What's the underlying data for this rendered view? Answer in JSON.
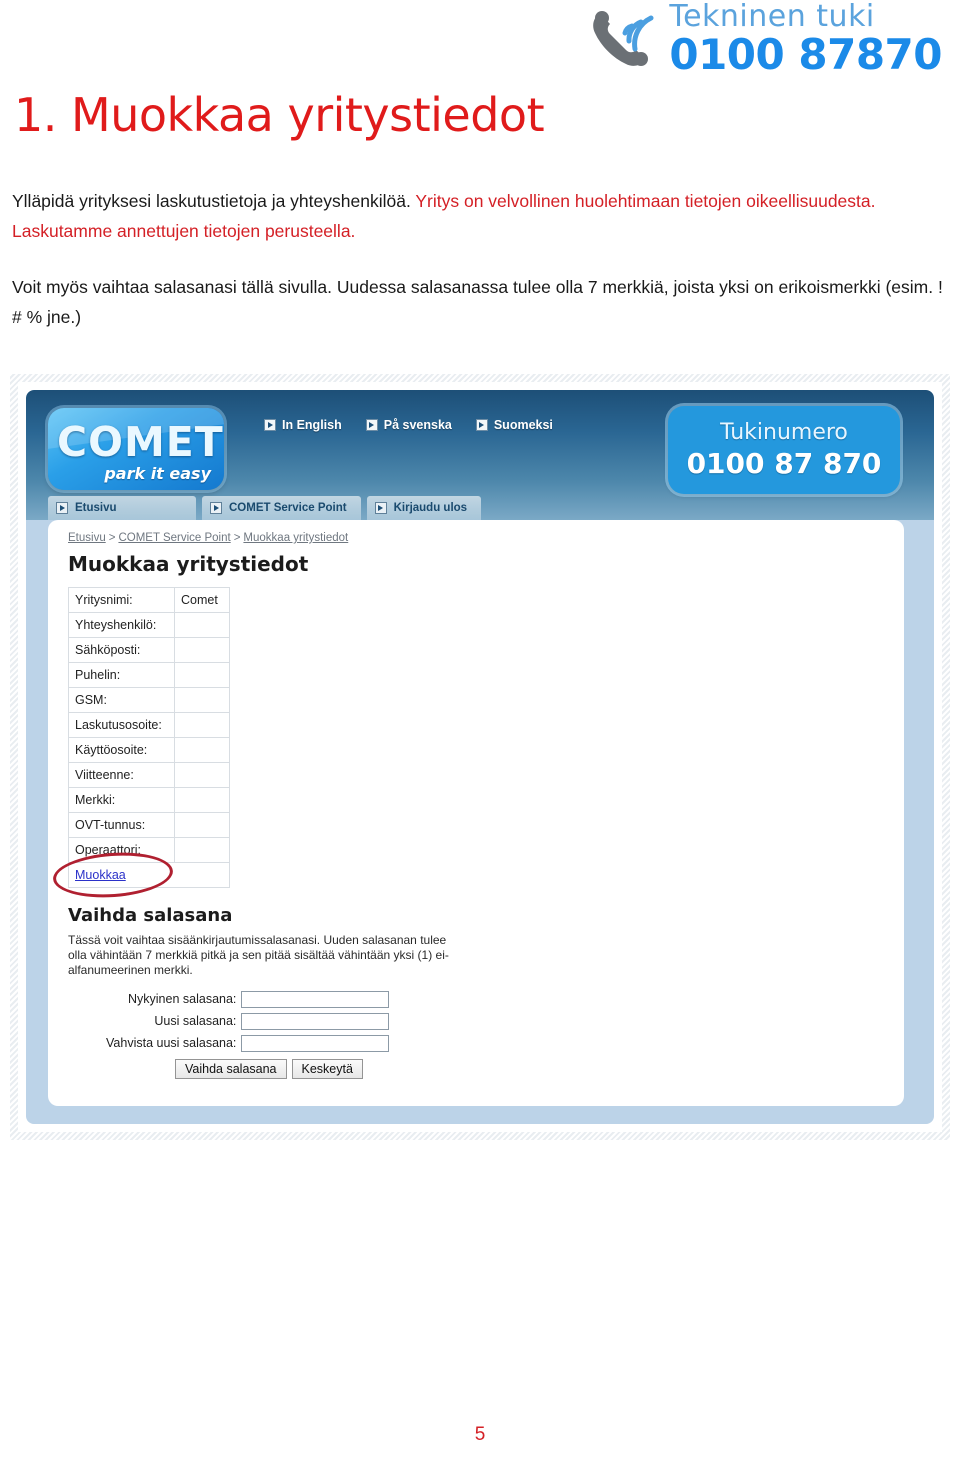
{
  "doc": {
    "support": {
      "label": "Tekninen tuki",
      "number": "0100 87870",
      "icon": "phone-ringing-icon"
    },
    "title": "1. Muokkaa yritystiedot",
    "paragraph1_black": "Ylläpidä yrityksesi laskutustietoja ja yhteyshenkilöä. ",
    "paragraph1_red": "Yritys on velvollinen huolehtimaan tietojen oikeellisuudesta. Laskutamme annettujen tietojen perusteella.",
    "paragraph2": "Voit myös vaihtaa salasanasi tällä sivulla. Uudessa salasanassa tulee olla 7 merkkiä, joista yksi on erikoismerkki (esim. ! # % jne.)",
    "page_number": "5",
    "colors": {
      "accent_red": "#d42026",
      "brand_blue": "#1b8ae8",
      "link_blue": "#2b31c9",
      "annotation_red": "#b02030"
    }
  },
  "screenshot": {
    "logo": {
      "word": "COMET",
      "tagline": "park it easy"
    },
    "languages": [
      {
        "label": "In English",
        "icon": "play-square-icon"
      },
      {
        "label": "På svenska",
        "icon": "play-square-icon"
      },
      {
        "label": "Suomeksi",
        "icon": "play-square-icon"
      }
    ],
    "support_badge": {
      "label": "Tukinumero",
      "number": "0100 87 870"
    },
    "nav": [
      {
        "label": "Etusivu",
        "icon": "play-square-icon"
      },
      {
        "label": "COMET Service Point",
        "icon": "play-square-icon"
      },
      {
        "label": "Kirjaudu ulos",
        "icon": "play-square-icon"
      }
    ],
    "breadcrumb": [
      "Etusivu",
      "COMET Service Point",
      "Muokkaa yritystiedot"
    ],
    "breadcrumb_separator": ">",
    "page_heading": "Muokkaa yritystiedot",
    "company_form": {
      "rows": [
        {
          "label": "Yritysnimi:",
          "value": "Comet"
        },
        {
          "label": "Yhteyshenkilö:",
          "value": ""
        },
        {
          "label": "Sähköposti:",
          "value": ""
        },
        {
          "label": "Puhelin:",
          "value": ""
        },
        {
          "label": "GSM:",
          "value": ""
        },
        {
          "label": "Laskutusosoite:",
          "value": ""
        },
        {
          "label": "Käyttöosoite:",
          "value": ""
        },
        {
          "label": "Viitteenne:",
          "value": ""
        },
        {
          "label": "Merkki:",
          "value": ""
        },
        {
          "label": "OVT-tunnus:",
          "value": ""
        },
        {
          "label": "Operaattori:",
          "value": ""
        }
      ],
      "edit_link": "Muokkaa"
    },
    "password_section": {
      "heading": "Vaihda salasana",
      "description": "Tässä voit vaihtaa sisäänkirjautumissalasanasi. Uuden salasanan tulee olla vähintään 7 merkkiä pitkä ja sen pitää sisältää vähintään yksi (1) ei-alfanumeerinen merkki.",
      "fields": [
        {
          "label": "Nykyinen salasana:",
          "value": "",
          "placeholder": ""
        },
        {
          "label": "Uusi salasana:",
          "value": "",
          "placeholder": ""
        },
        {
          "label": "Vahvista uusi salasana:",
          "value": "",
          "placeholder": ""
        }
      ],
      "submit_label": "Vaihda salasana",
      "cancel_label": "Keskeytä"
    }
  }
}
